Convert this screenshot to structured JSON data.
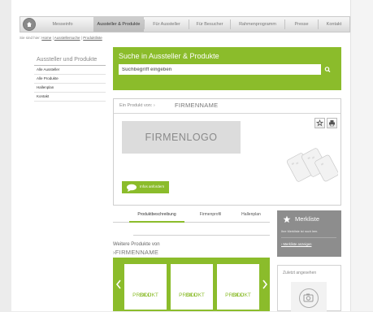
{
  "nav": {
    "items": [
      {
        "label": "Messeinfo"
      },
      {
        "label": "Aussteller & Produkte"
      },
      {
        "label": "Für Aussteller"
      },
      {
        "label": "Für Besucher"
      },
      {
        "label": "Rahmenprogramm"
      },
      {
        "label": "Presse"
      },
      {
        "label": "Kontakt"
      }
    ]
  },
  "breadcrumb": {
    "prefix": "Sie sind hier:",
    "items": [
      {
        "label": "Home"
      },
      {
        "label": "Ausstellersuche"
      },
      {
        "label": "Produktliste"
      }
    ],
    "separator": "|"
  },
  "sidebar": {
    "title": "Aussteller und Produkte",
    "items": [
      {
        "label": "Alle Aussteller"
      },
      {
        "label": "Alle Produkte"
      },
      {
        "label": "Hallenplan"
      },
      {
        "label": "Kontakt"
      }
    ]
  },
  "search": {
    "title": "Suche in Aussteller & Produkte",
    "placeholder": "Suchbegriff eingeben"
  },
  "product": {
    "from_label": "Ein Produkt von: ›",
    "company": "FIRMENNAME",
    "logo_text": "FIRMENLOGO",
    "info_button": "Infos anfordern"
  },
  "tabs": [
    {
      "label": "Produktbeschreibung",
      "active": true
    },
    {
      "label": "Firmenprofil",
      "active": false
    },
    {
      "label": "Hallenplan",
      "active": false
    }
  ],
  "more": {
    "label": "Weitere Produkte von",
    "company": "›FIRMENNAME",
    "cards": [
      {
        "line1": "PRODUKT",
        "line2": "BILD"
      },
      {
        "line1": "PRODUKT",
        "line2": "BILD"
      },
      {
        "line1": "PRODUKT",
        "line2": "BILD"
      }
    ]
  },
  "merkliste": {
    "title": "Merkliste",
    "text": "Ihre Merkliste ist noch leer.",
    "link": "› Merkliste anzeigen"
  },
  "recent": {
    "title": "Zuletzt angesehen"
  },
  "colors": {
    "accent": "#8bbc2b",
    "merk_bg": "#8d8d8d",
    "logo_bg": "#dcdcdc"
  }
}
